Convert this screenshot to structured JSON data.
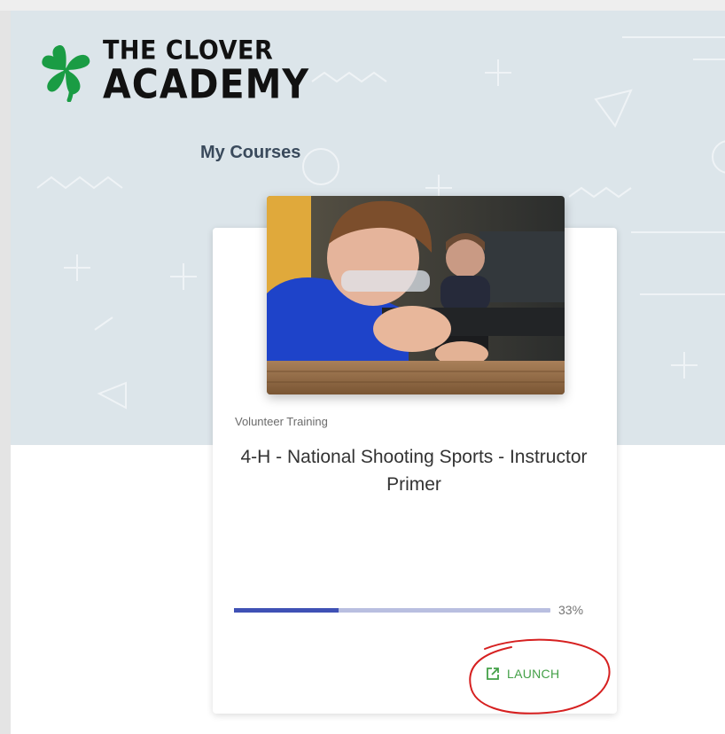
{
  "brand": {
    "line1": "THE CLOVER",
    "line2": "ACADEMY",
    "clover_color": "#1a9c44"
  },
  "section_title": "My Courses",
  "course": {
    "category": "Volunteer Training",
    "title": "4-H - National Shooting Sports - Instructor Primer",
    "progress_percent": 33,
    "progress_label": "33%",
    "launch_label": "LAUNCH",
    "launch_icon": "open-in-new-icon"
  },
  "colors": {
    "hero_bg": "#dce5ea",
    "progress_fill": "#3f51b5",
    "progress_track": "#b9bfe0",
    "launch": "#43a047",
    "annotation": "#d62020"
  }
}
